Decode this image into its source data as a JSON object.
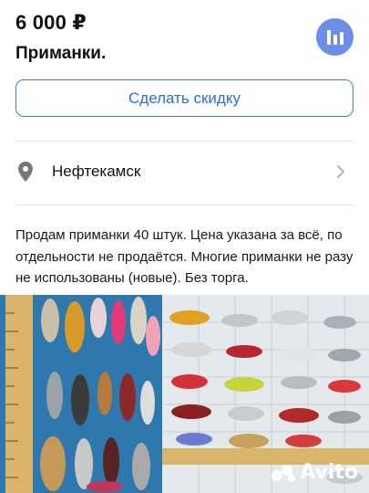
{
  "listing": {
    "price": "6 000 ₽",
    "title": "Приманки.",
    "discount_label": "Сделать скидку",
    "location": "Нефтекамск",
    "description": "Продам приманки 40 штук. Цена указана за всё, по отдельности не продаётся. Многие приманки не разу не использованы (новые). Без торга."
  },
  "icons": {
    "stats": "bar-chart-icon",
    "location": "map-pin-icon",
    "chevron": "chevron-right-icon"
  },
  "photos": {
    "watermark": "Avito"
  },
  "colors": {
    "accent": "#6c8ee8",
    "link": "#2a6fd3",
    "border": "#3b82d6"
  }
}
